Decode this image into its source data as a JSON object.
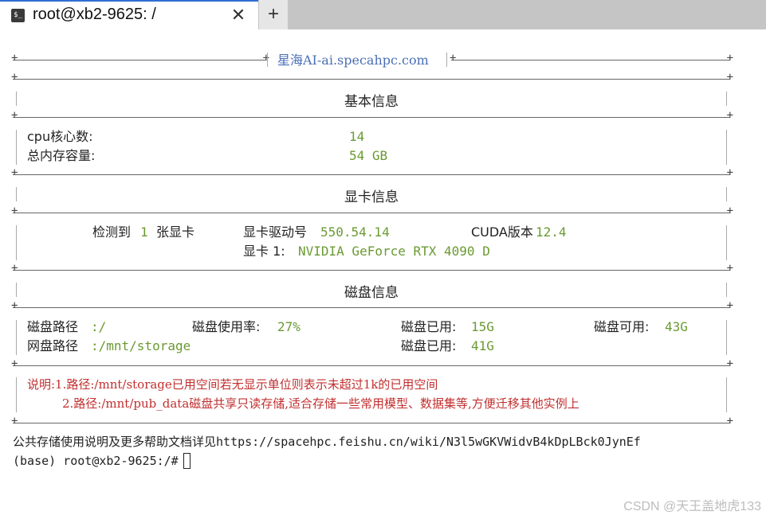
{
  "window": {
    "tab_title": "root@xb2-9625: /",
    "tab_icon": "terminal-icon",
    "close_glyph": "✕",
    "new_tab_glyph": "+"
  },
  "banner": {
    "site": "星海AI-ai.specahpc.com"
  },
  "basic": {
    "header": "基本信息",
    "cpu_label": "cpu核心数:",
    "cpu_value": "14",
    "mem_label": "总内存容量:",
    "mem_value": "54 GB"
  },
  "gpu": {
    "header": "显卡信息",
    "detected_label": "检测到",
    "detected_value": "1",
    "detected_unit": "张显卡",
    "driver_label": "显卡驱动号",
    "driver_value": "550.54.14",
    "cuda_label": "CUDA版本",
    "cuda_value": "12.4",
    "card_label": "显卡 1:",
    "card_value": "NVIDIA GeForce RTX 4090 D"
  },
  "disk": {
    "header": "磁盘信息",
    "path_label": "磁盘路径",
    "path_value": ":/",
    "usage_label": "磁盘使用率:",
    "usage_value": "27%",
    "used_label": "磁盘已用:",
    "used_value": "15G",
    "free_label": "磁盘可用:",
    "free_value": "43G",
    "net_label": "网盘路径",
    "net_value": ":/mnt/storage",
    "net_used_label": "磁盘已用:",
    "net_used_value": "41G"
  },
  "notes": {
    "line1": "说明:1.路径:/mnt/storage已用空间若无显示单位则表示未超过1k的已用空间",
    "line2": "2.路径:/mnt/pub_data磁盘共享只读存储,适合存储一些常用模型、数据集等,方便迁移其他实例上"
  },
  "footer": {
    "help": "公共存储使用说明及更多帮助文档详见https://spacehpc.feishu.cn/wiki/N3l5wGKVWidvB4kDpLBck0JynEf",
    "prompt": "(base) root@xb2-9625:/# "
  },
  "watermark": "CSDN @天王盖地虎133"
}
